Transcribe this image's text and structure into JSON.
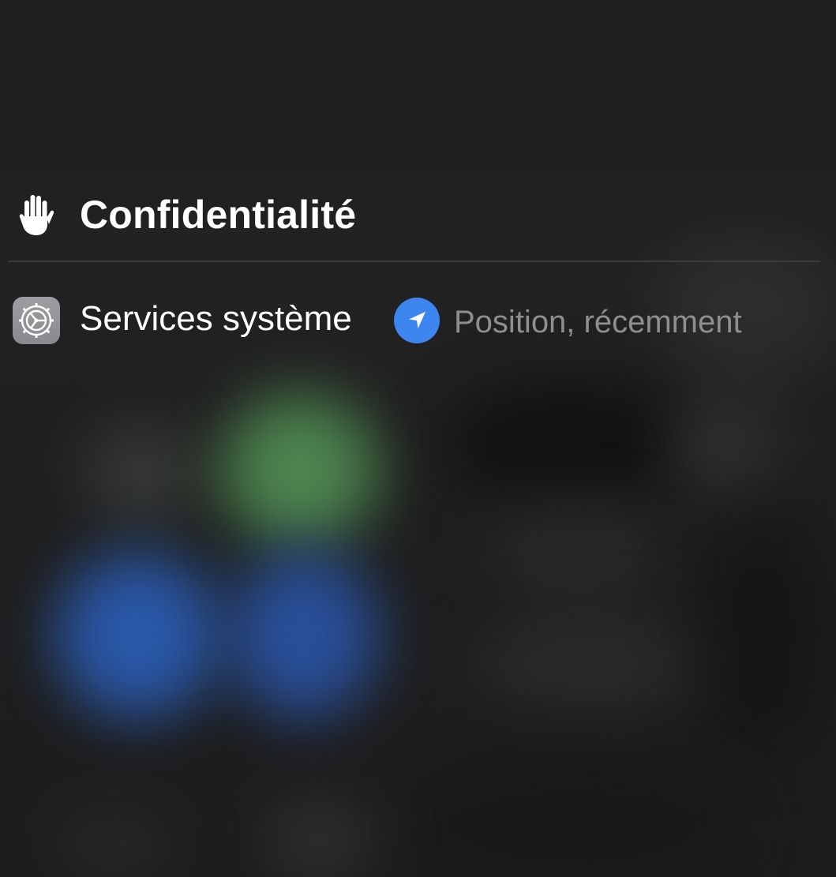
{
  "section": {
    "title": "Confidentialité",
    "icon": "hand-raised-icon"
  },
  "item": {
    "label": "Services système",
    "app_icon": "settings-gear-icon",
    "status_icon": "location-arrow-icon",
    "status_text": "Position, récemment"
  },
  "colors": {
    "location_accent": "#3d86f0",
    "title_text": "#ffffff",
    "status_text": "#8f8f8f",
    "app_icon_bg": "#8e8e93"
  }
}
